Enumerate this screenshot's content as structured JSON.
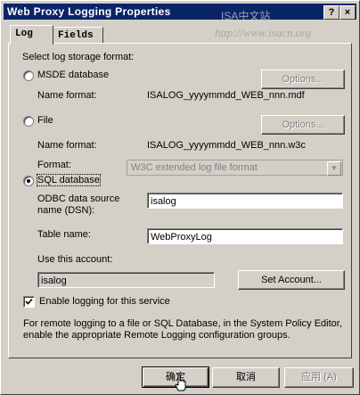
{
  "window": {
    "title": "Web Proxy Logging Properties",
    "watermark_title": "ISA中文站",
    "watermark_url": "http://www.isacn.org",
    "help_button": "?",
    "close_button": "×"
  },
  "tabs": [
    {
      "label": "Log",
      "active": true
    },
    {
      "label": "Fields",
      "active": false
    }
  ],
  "log_tab": {
    "storage_heading": "Select log storage format:",
    "msde": {
      "label": "MSDE database",
      "selected": false,
      "options_label": "Options...",
      "name_format_label": "Name format:",
      "name_format_value": "ISALOG_yyyymmdd_WEB_nnn.mdf"
    },
    "file": {
      "label": "File",
      "selected": false,
      "options_label": "Options...",
      "name_format_label": "Name format:",
      "name_format_value": "ISALOG_yyyymmdd_WEB_nnn.w3c",
      "format_label": "Format:",
      "format_value": "W3C extended log file format"
    },
    "sql": {
      "label": "SQL database",
      "selected": true,
      "dsn_label_line1": "ODBC data source",
      "dsn_label_line2": "name (DSN):",
      "dsn_value": "isalog",
      "table_label": "Table name:",
      "table_value": "WebProxyLog",
      "account_label": "Use this account:",
      "account_value": "isalog",
      "set_account_label": "Set Account..."
    },
    "enable_logging": {
      "label": "Enable logging for this service",
      "checked": true
    },
    "note_line1": "For remote logging to a file or SQL Database, in the System Policy Editor,",
    "note_line2": "enable the appropriate Remote Logging configuration groups."
  },
  "footer": {
    "ok_label": "确定",
    "cancel_label": "取消",
    "apply_label": "应用 (A)"
  }
}
